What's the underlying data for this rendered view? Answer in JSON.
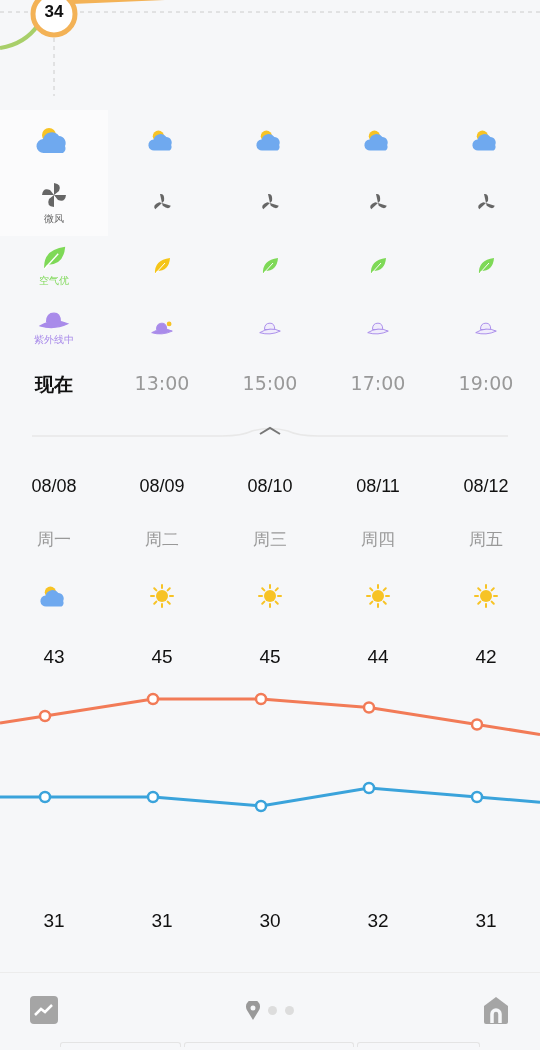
{
  "hourly_chart": {
    "badge": "34"
  },
  "hourly": [
    {
      "time": "现在",
      "selected": true,
      "wind_label": "微风",
      "air_quality": {
        "label": "空气优",
        "color": "#7ed957"
      },
      "uv": {
        "label": "紫外线中",
        "kind": "filled"
      }
    },
    {
      "time": "13:00",
      "selected": false,
      "air_quality": {
        "color": "#f5c518"
      },
      "uv": {
        "kind": "sun"
      }
    },
    {
      "time": "15:00",
      "selected": false,
      "air_quality": {
        "color": "#7ed957"
      },
      "uv": {
        "kind": "outline"
      }
    },
    {
      "time": "17:00",
      "selected": false,
      "air_quality": {
        "color": "#7ed957"
      },
      "uv": {
        "kind": "outline"
      }
    },
    {
      "time": "19:00",
      "selected": false,
      "air_quality": {
        "color": "#7ed957"
      },
      "uv": {
        "kind": "outline"
      }
    }
  ],
  "daily": [
    {
      "date": "08/08",
      "weekday": "周一",
      "weather": {
        "kind": "cloudy"
      },
      "high": "43",
      "low": "31"
    },
    {
      "date": "08/09",
      "weekday": "周二",
      "weather": {
        "kind": "sunny"
      },
      "high": "45",
      "low": "31"
    },
    {
      "date": "08/10",
      "weekday": "周三",
      "weather": {
        "kind": "sunny"
      },
      "high": "45",
      "low": "30"
    },
    {
      "date": "08/11",
      "weekday": "周四",
      "weather": {
        "kind": "sunny"
      },
      "high": "44",
      "low": "32"
    },
    {
      "date": "08/12",
      "weekday": "周五",
      "weather": {
        "kind": "sunny"
      },
      "high": "42",
      "low": "31"
    }
  ]
}
